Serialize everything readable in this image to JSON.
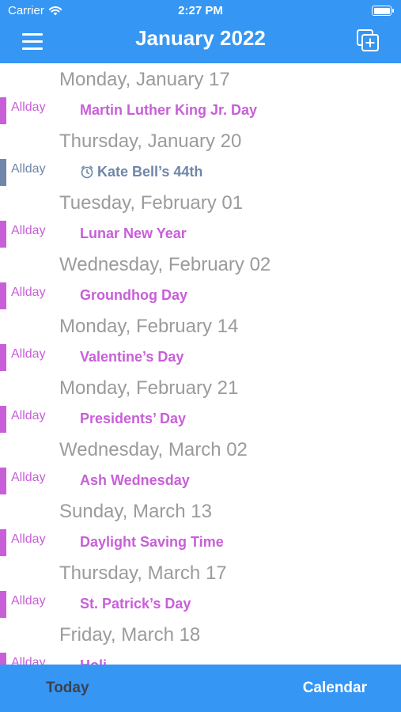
{
  "status_bar": {
    "carrier": "Carrier",
    "time": "2:27 PM"
  },
  "nav": {
    "title": "January 2022",
    "menu_icon": "hamburger-menu-icon",
    "add_icon": "add-event-icon"
  },
  "colors": {
    "accent": "#3696f3",
    "holiday": "#c85fd8",
    "birthday": "#6f86a8",
    "date_header": "#9b9b9b"
  },
  "days": [
    {
      "date": "Monday, January 17",
      "allday": "Allday",
      "event": "Martin Luther King Jr. Day",
      "kind": "holiday"
    },
    {
      "date": "Thursday, January 20",
      "allday": "Allday",
      "event": "Kate Bell’s 44th",
      "kind": "birthday",
      "icon": "alarm-clock-icon"
    },
    {
      "date": "Tuesday, February 01",
      "allday": "Allday",
      "event": "Lunar New Year",
      "kind": "holiday"
    },
    {
      "date": "Wednesday, February 02",
      "allday": "Allday",
      "event": "Groundhog Day",
      "kind": "holiday"
    },
    {
      "date": "Monday, February 14",
      "allday": "Allday",
      "event": "Valentine’s Day",
      "kind": "holiday"
    },
    {
      "date": "Monday, February 21",
      "allday": "Allday",
      "event": "Presidents’ Day",
      "kind": "holiday"
    },
    {
      "date": "Wednesday, March 02",
      "allday": "Allday",
      "event": "Ash Wednesday",
      "kind": "holiday"
    },
    {
      "date": "Sunday, March 13",
      "allday": "Allday",
      "event": "Daylight Saving Time",
      "kind": "holiday"
    },
    {
      "date": "Thursday, March 17",
      "allday": "Allday",
      "event": "St. Patrick’s Day",
      "kind": "holiday"
    },
    {
      "date": "Friday, March 18",
      "allday": "Allday",
      "event": "Holi",
      "kind": "holiday"
    }
  ],
  "tabs": {
    "today": "Today",
    "calendar": "Calendar"
  }
}
